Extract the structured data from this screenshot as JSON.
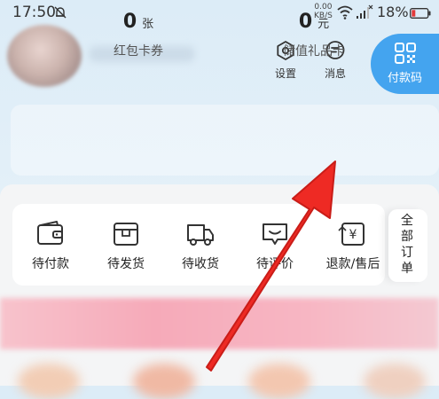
{
  "status_bar": {
    "time": "17:50",
    "net_speed_value": "0.00",
    "net_speed_unit": "KB/S",
    "battery_percent": "18%"
  },
  "header": {
    "settings_label": "设置",
    "messages_label": "消息",
    "pay_code_label": "付款码"
  },
  "wallet": {
    "coupon": {
      "count": "0",
      "unit": "张",
      "label": "红包卡券"
    },
    "gift_card": {
      "count": "0",
      "unit": "元",
      "label": "储值礼品卡"
    }
  },
  "orders": {
    "items": [
      {
        "label": "待付款",
        "icon": "wallet-icon"
      },
      {
        "label": "待发货",
        "icon": "package-icon"
      },
      {
        "label": "待收货",
        "icon": "truck-icon"
      },
      {
        "label": "待评价",
        "icon": "comment-icon"
      },
      {
        "label": "退款/售后",
        "icon": "refund-icon"
      }
    ],
    "all_label": "全部订单"
  },
  "colors": {
    "accent_blue": "#44a4ef",
    "annotation_red": "#ee2a24",
    "banner_pink": "#f6aab9"
  }
}
